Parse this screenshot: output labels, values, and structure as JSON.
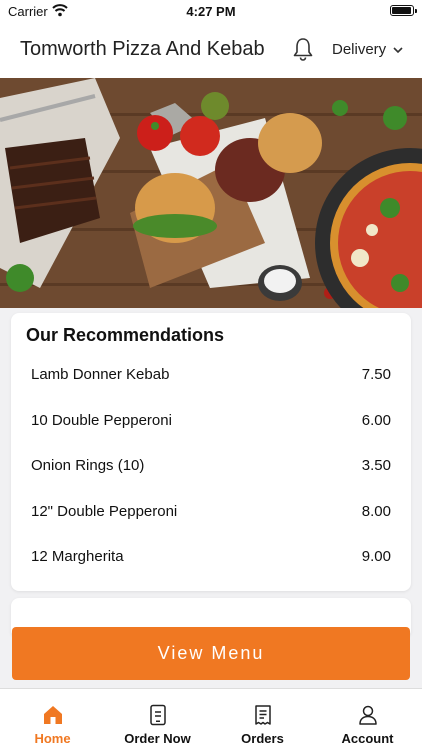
{
  "status_bar": {
    "carrier": "Carrier",
    "time": "4:27 PM"
  },
  "header": {
    "title": "Tomworth Pizza And Kebab",
    "order_mode": "Delivery"
  },
  "recommendations": {
    "heading": "Our Recommendations",
    "items": [
      {
        "name": "Lamb Donner Kebab",
        "price": "7.50"
      },
      {
        "name": "10 Double Pepperoni",
        "price": "6.00"
      },
      {
        "name": "Onion Rings (10)",
        "price": "3.50"
      },
      {
        "name": "12\" Double Pepperoni",
        "price": "8.00"
      },
      {
        "name": "12 Margherita",
        "price": "9.00"
      }
    ]
  },
  "cta": {
    "label": "View Menu"
  },
  "tabs": [
    {
      "label": "Home",
      "icon": "home-icon",
      "active": true
    },
    {
      "label": "Order Now",
      "icon": "order-icon",
      "active": false
    },
    {
      "label": "Orders",
      "icon": "receipt-icon",
      "active": false
    },
    {
      "label": "Account",
      "icon": "account-icon",
      "active": false
    }
  ],
  "colors": {
    "accent": "#f07822",
    "background": "#f1f1f3",
    "table_wood": "#6e4a30"
  }
}
